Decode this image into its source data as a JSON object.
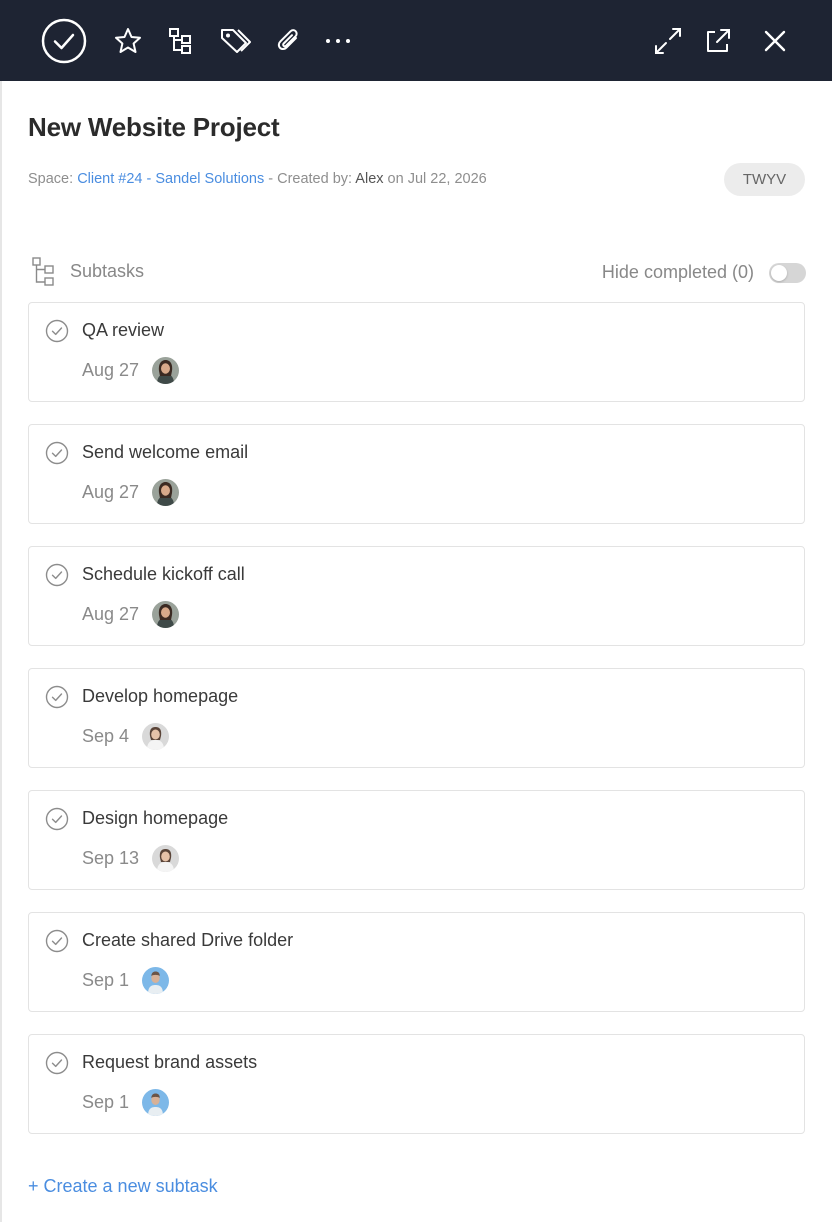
{
  "header": {
    "icons": [
      "complete-check-icon",
      "star-icon",
      "subtasks-icon",
      "tag-icon",
      "paperclip-icon",
      "more-icon",
      "expand-icon",
      "open-external-icon",
      "close-icon"
    ]
  },
  "task": {
    "title": "New Website Project",
    "space_prefix": "Space:",
    "space_link": "Client #24 - Sandel Solutions",
    "created_by_prefix": "- Created by:",
    "creator": "Alex",
    "created_on": "on Jul 22, 2026",
    "badge": "TWYV"
  },
  "subtasks": {
    "label": "Subtasks",
    "hide_completed": "Hide completed (0)",
    "items": [
      {
        "name": "QA review",
        "due": "Aug 27",
        "avatar": "woman-dark-hair"
      },
      {
        "name": "Send welcome email",
        "due": "Aug 27",
        "avatar": "woman-dark-hair"
      },
      {
        "name": "Schedule kickoff call",
        "due": "Aug 27",
        "avatar": "woman-dark-hair"
      },
      {
        "name": "Develop homepage",
        "due": "Sep 4",
        "avatar": "woman-light"
      },
      {
        "name": "Design homepage",
        "due": "Sep 13",
        "avatar": "woman-light"
      },
      {
        "name": "Create shared Drive folder",
        "due": "Sep 1",
        "avatar": "man-blue-bg"
      },
      {
        "name": "Request brand assets",
        "due": "Sep 1",
        "avatar": "man-blue-bg"
      }
    ],
    "create_label": "+ Create a new subtask"
  },
  "colors": {
    "topbar": "#1e2433",
    "link": "#4a8de0",
    "card_border": "#e3e3e3"
  }
}
